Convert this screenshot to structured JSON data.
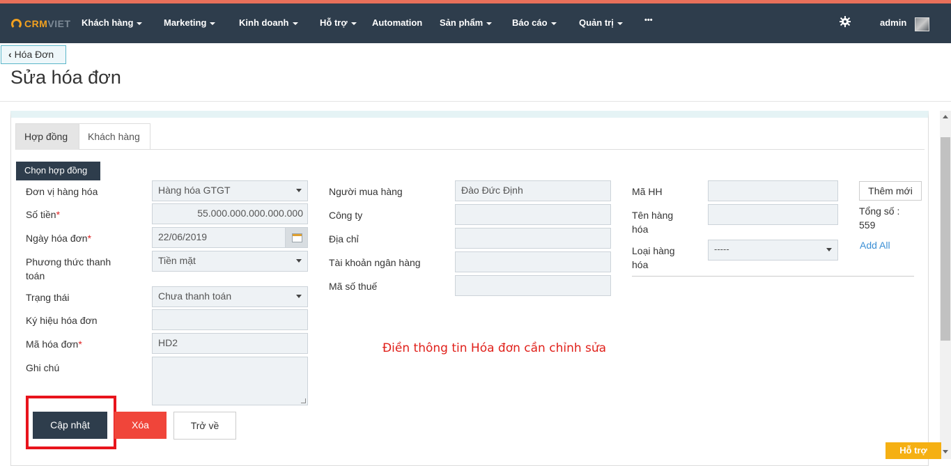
{
  "brand": {
    "part1": "CRM",
    "part2": "VIET"
  },
  "nav": {
    "items": [
      {
        "label": "Khách hàng",
        "caret": true
      },
      {
        "label": "Marketing",
        "caret": true
      },
      {
        "label": "Kinh doanh",
        "caret": true
      },
      {
        "label": "Hỗ trợ",
        "caret": true
      },
      {
        "label": "Automation",
        "caret": false
      },
      {
        "label": "Sản phẩm",
        "caret": true
      },
      {
        "label": "Báo cáo",
        "caret": true
      },
      {
        "label": "Quản trị",
        "caret": true
      },
      {
        "label": "•••",
        "caret": false
      }
    ],
    "user": "admin"
  },
  "breadcrumb": {
    "back_label": "Hóa Đơn"
  },
  "page": {
    "title": "Sửa hóa đơn"
  },
  "tabs": [
    {
      "label": "Hợp đồng",
      "active": true
    },
    {
      "label": "Khách hàng",
      "active": false
    }
  ],
  "form": {
    "choose_contract": "Chọn hợp đồng",
    "left": {
      "unit_label": "Đơn vị hàng hóa",
      "unit_value": "Hàng hóa GTGT",
      "amount_label": "Số tiền",
      "amount_value": "55.000.000.000.000.000",
      "date_label": "Ngày hóa đơn",
      "date_value": "22/06/2019",
      "payment_label": "Phương thức thanh toán",
      "payment_value": "Tiền mặt",
      "status_label": "Trạng thái",
      "status_value": "Chưa thanh toán",
      "symbol_label": "Ký hiệu hóa đơn",
      "symbol_value": "",
      "code_label": "Mã hóa đơn",
      "code_value": "HD2",
      "note_label": "Ghi chú",
      "required_mark": "*"
    },
    "middle": {
      "buyer_label": "Người mua hàng",
      "buyer_value": "Đào Đức Định",
      "company_label": "Công ty",
      "address_label": "Địa chỉ",
      "bank_label": "Tài khoản ngân hàng",
      "tax_label": "Mã số thuế"
    },
    "right": {
      "product_code_label": "Mã HH",
      "product_name_label": "Tên hàng hóa",
      "product_type_label": "Loại hàng hóa",
      "product_type_value": "-----",
      "add_new": "Thêm mới",
      "total": "Tổng số : 559",
      "add_all": "Add All"
    },
    "annotation": "Điền thông tin Hóa đơn cần chỉnh sửa"
  },
  "actions": {
    "update": "Cập nhật",
    "delete": "Xóa",
    "back": "Trở về"
  },
  "support": {
    "label": "Hỗ trợ"
  }
}
